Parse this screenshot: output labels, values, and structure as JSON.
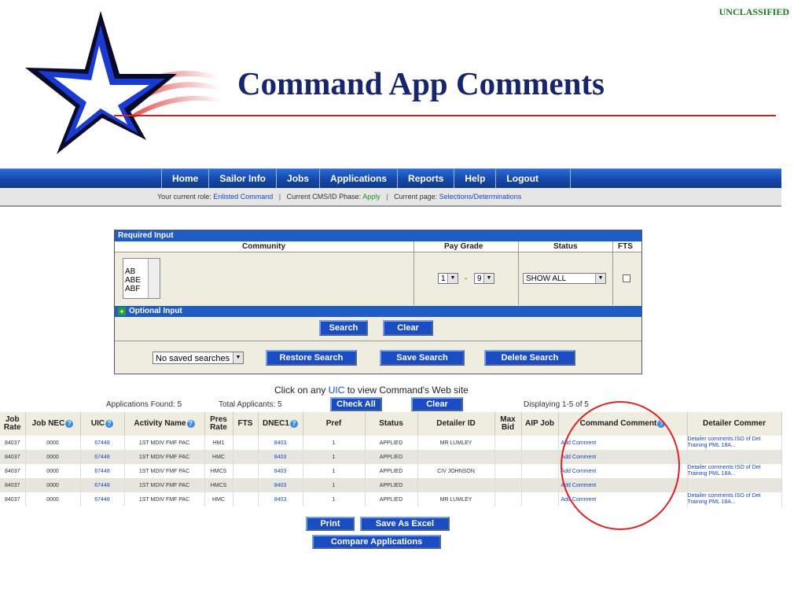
{
  "classification": "UNCLASSIFIED",
  "page_title": "Command App Comments",
  "nav": {
    "items": [
      {
        "label": "Home",
        "name": "nav-home"
      },
      {
        "label": "Sailor Info",
        "name": "nav-sailor-info"
      },
      {
        "label": "Jobs",
        "name": "nav-jobs"
      },
      {
        "label": "Applications",
        "name": "nav-applications"
      },
      {
        "label": "Reports",
        "name": "nav-reports"
      },
      {
        "label": "Help",
        "name": "nav-help"
      },
      {
        "label": "Logout",
        "name": "nav-logout"
      }
    ]
  },
  "role_bar": {
    "role_label": "Your current role:",
    "role_value": "Enlisted Command",
    "phase_label": "Current CMS/ID Phase:",
    "phase_value": "Apply",
    "page_label": "Current page:",
    "page_value": "Selections/Determinations"
  },
  "search_panel": {
    "required_header": "Required Input",
    "col_community": "Community",
    "col_pay_grade": "Pay Grade",
    "col_status": "Status",
    "col_fts": "FTS",
    "community_options": [
      "AB",
      "ABE",
      "ABF"
    ],
    "pay_grade_from": "1",
    "pay_grade_sep": "-",
    "pay_grade_to": "9",
    "status_value": "SHOW ALL",
    "optional_header": "Optional Input",
    "optional_plus": "+",
    "search_button": "Search",
    "clear_button": "Clear",
    "saved_searches_value": "No saved searches",
    "restore_button": "Restore Search",
    "save_button": "Save Search",
    "delete_button": "Delete Search"
  },
  "uic_note": {
    "prefix": "Click on any ",
    "link": "UIC",
    "suffix": " to view Command's Web site"
  },
  "results_bar": {
    "applications_found": "Applications Found: 5",
    "total_applicants": "Total Applicants: 5",
    "check_all_button": "Check All",
    "clear_button": "Clear",
    "displaying": "Displaying 1-5 of 5"
  },
  "table": {
    "headers": {
      "job_rate": "Job Rate",
      "job_nec": "Job NEC",
      "uic": "UIC",
      "activity_name": "Activity Name",
      "pres_rate": "Pres Rate",
      "fts": "FTS",
      "dnec1": "DNEC1",
      "pref": "Pref",
      "status": "Status",
      "detailer_id": "Detailer ID",
      "max_bid": "Max Bid",
      "aip_job": "AIP Job",
      "command_comment": "Command Comment",
      "detailer_comment": "Detailer Commer"
    },
    "help_glyph": "?",
    "rows": [
      {
        "job_rate": "84037",
        "job_nec": "0000",
        "uic": "67448",
        "activity": "1ST MDIV FMF PAC",
        "pres_rate": "HM1",
        "fts": "",
        "dnec1": "8403",
        "pref": "1",
        "status": "APPLIED",
        "detailer_id": "MR LUMLEY",
        "max_bid": "",
        "aip_job": "",
        "command_comment": "Add Comment",
        "detailer_comment": "Detailer comments ISO of Det Training PML 18A..."
      },
      {
        "job_rate": "84037",
        "job_nec": "0000",
        "uic": "67448",
        "activity": "1ST MDIV FMF PAC",
        "pres_rate": "HMC",
        "fts": "",
        "dnec1": "8403",
        "pref": "1",
        "status": "APPLIED",
        "detailer_id": "",
        "max_bid": "",
        "aip_job": "",
        "command_comment": "Add Comment",
        "detailer_comment": ""
      },
      {
        "job_rate": "84037",
        "job_nec": "0000",
        "uic": "67448",
        "activity": "1ST MDIV FMF PAC",
        "pres_rate": "HMCS",
        "fts": "",
        "dnec1": "8403",
        "pref": "1",
        "status": "APPLIED",
        "detailer_id": "CIV JOHNSON",
        "max_bid": "",
        "aip_job": "",
        "command_comment": "Add Comment",
        "detailer_comment": "Detailer comments ISO of Det Training PML 18A..."
      },
      {
        "job_rate": "84037",
        "job_nec": "0000",
        "uic": "67448",
        "activity": "1ST MDIV FMF PAC",
        "pres_rate": "HMCS",
        "fts": "",
        "dnec1": "8403",
        "pref": "1",
        "status": "APPLIED",
        "detailer_id": "",
        "max_bid": "",
        "aip_job": "",
        "command_comment": "Add Comment",
        "detailer_comment": ""
      },
      {
        "job_rate": "84037",
        "job_nec": "0000",
        "uic": "67448",
        "activity": "1ST MDIV FMF PAC",
        "pres_rate": "HMC",
        "fts": "",
        "dnec1": "8403",
        "pref": "1",
        "status": "APPLIED",
        "detailer_id": "MR LUMLEY",
        "max_bid": "",
        "aip_job": "",
        "command_comment": "Add Comment",
        "detailer_comment": "Detailer comments ISO of Det Training PML 18A..."
      }
    ]
  },
  "bottom_buttons": {
    "print": "Print",
    "save_excel": "Save As Excel",
    "compare": "Compare Applications"
  },
  "colors": {
    "nav_blue": "#1548a8",
    "title_navy": "#17246e",
    "accent_red": "#cc2222",
    "link_blue": "#1a44c4",
    "classification_green": "#1a7a1a"
  }
}
